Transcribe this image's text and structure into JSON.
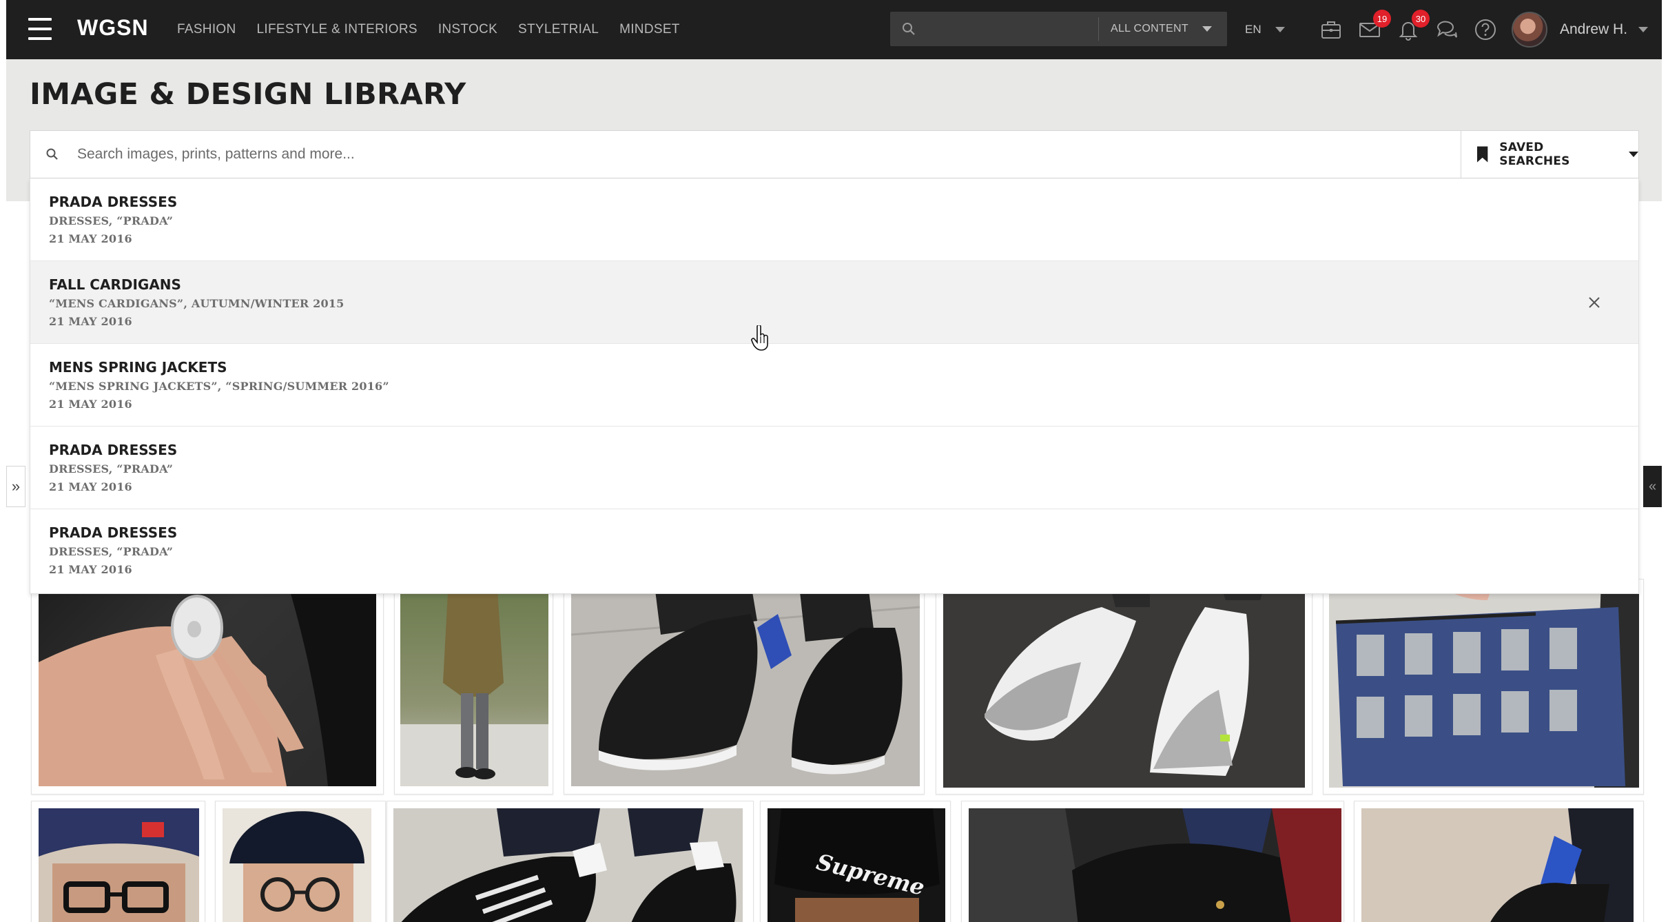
{
  "topbar": {
    "logo": "WGSN",
    "nav": [
      "FASHION",
      "LIFESTYLE & INTERIORS",
      "INSTOCK",
      "STYLETRIAL",
      "MINDSET"
    ],
    "search_scope": "ALL CONTENT",
    "language": "EN",
    "mail_count": "19",
    "notifications_count": "30",
    "user_name": "Andrew H."
  },
  "library": {
    "title": "IMAGE & DESIGN LIBRARY",
    "search_placeholder": "Search images, prints, patterns and more...",
    "saved_searches_label": "SAVED SEARCHES"
  },
  "saved_searches": [
    {
      "title": "PRADA DRESSES",
      "terms": "DRESSES, “PRADA”",
      "date": "21 MAY 2016"
    },
    {
      "title": "FALL CARDIGANS",
      "terms": "“MENS CARDIGANS”, AUTUMN/WINTER 2015",
      "date": "21 MAY 2016"
    },
    {
      "title": "MENS SPRING JACKETS",
      "terms": "“MENS SPRING JACKETS”, “SPRING/SUMMER 2016”",
      "date": "21 MAY 2016"
    },
    {
      "title": "PRADA DRESSES",
      "terms": "DRESSES, “PRADA”",
      "date": "21 MAY 2016"
    },
    {
      "title": "PRADA DRESSES",
      "terms": "DRESSES, “PRADA”",
      "date": "21 MAY 2016"
    }
  ],
  "image_grid": {
    "row1": [
      "hand with ring",
      "man in olive coat",
      "black slip-on shoes",
      "grey white sneakers",
      "patterned clutch bag"
    ],
    "row2": [
      "navy cap with glasses",
      "black beret with glasses",
      "black adidas sneakers",
      "supreme black beanie",
      "leather bag with jacket",
      "black shoe with blue sock"
    ],
    "beanie_text": "Supreme"
  },
  "colors": {
    "topbar_bg": "#1f1f1f",
    "header_bg": "#e8e8e6",
    "badge_red": "#e0202a"
  }
}
